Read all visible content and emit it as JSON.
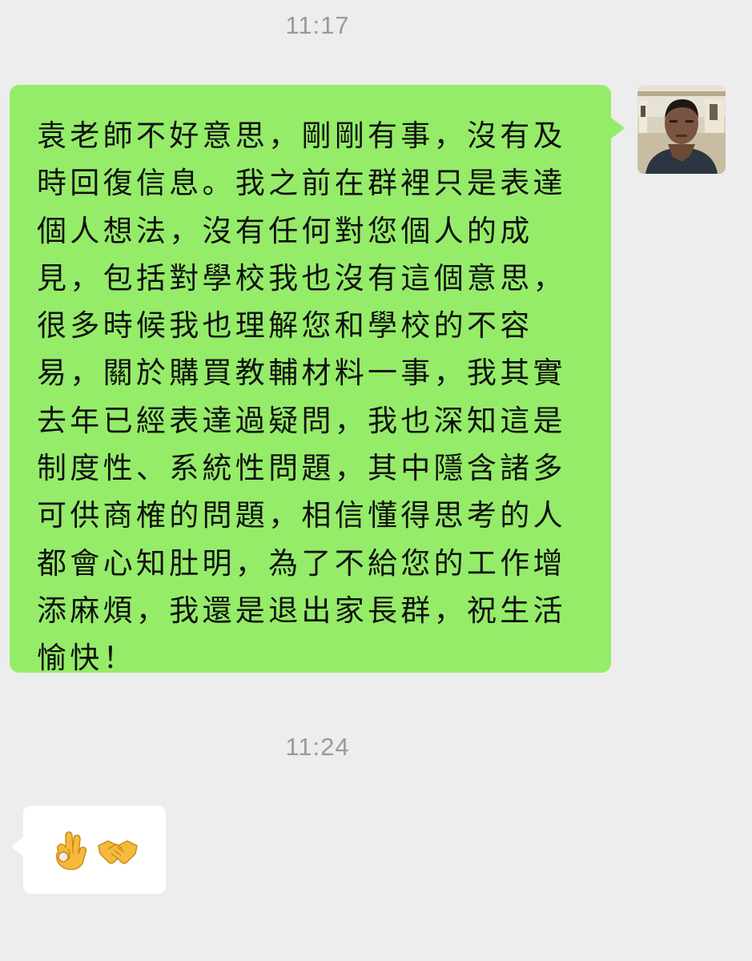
{
  "chat": {
    "timestamp_1": "11:17",
    "outgoing_message": "袁老師不好意思，剛剛有事，沒有及時回復信息。我之前在群裡只是表達個人想法，沒有任何對您個人的成見，包括對學校我也沒有這個意思，很多時候我也理解您和學校的不容易，關於購買教輔材料一事，我其實去年已經表達過疑問，我也深知這是制度性、系統性問題，其中隱含諸多可供商榷的問題，相信懂得思考的人都會心知肚明，為了不給您的工作增添麻煩，我還是退出家長群，祝生活愉快！",
    "timestamp_2": "11:24",
    "reply_emojis": [
      "ok-hand-emoji",
      "handshake-emoji"
    ]
  },
  "colors": {
    "background": "#ededed",
    "outgoing_bubble": "#95ec69",
    "incoming_bubble": "#ffffff",
    "timestamp_text": "#9a9a9a",
    "message_text": "#111111"
  }
}
